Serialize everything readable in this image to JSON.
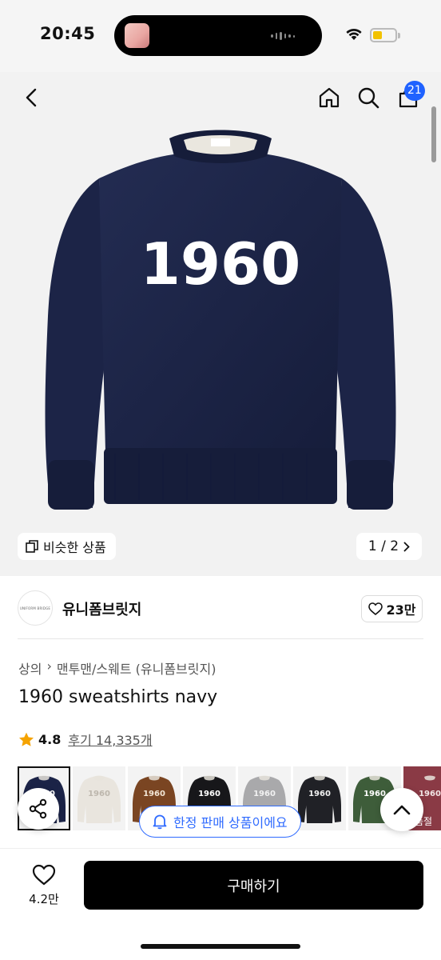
{
  "status_bar": {
    "time": "20:45"
  },
  "nav": {
    "cart_badge": "21"
  },
  "hero": {
    "print_text": "1960",
    "similar_label": "비슷한 상품",
    "pager": "1 / 2"
  },
  "brand": {
    "name": "유니폼브릿지",
    "logo_text": "UNIFORM BRIDGE",
    "likes": "23만"
  },
  "product": {
    "breadcrumb": [
      "상의",
      "맨투맨/스웨트 (유니폼브릿지)"
    ],
    "title": "1960 sweatshirts navy",
    "rating": "4.8",
    "review_label": "후기 14,335개"
  },
  "thumbnails": [
    {
      "name": "navy",
      "bg": "#f3f3f3",
      "color": "#1b2347",
      "text_color": "#ffffff",
      "selected": true
    },
    {
      "name": "ivory",
      "bg": "#f3f3f3",
      "color": "#e9e5de",
      "text_color": "#bdb7ad",
      "selected": false
    },
    {
      "name": "brown",
      "bg": "#f3f3f3",
      "color": "#7a4522",
      "text_color": "#f3e6d6",
      "selected": false
    },
    {
      "name": "black",
      "bg": "#f3f3f3",
      "color": "#17171a",
      "text_color": "#ffffff",
      "selected": false
    },
    {
      "name": "grey",
      "bg": "#f3f3f3",
      "color": "#a9a9ab",
      "text_color": "#f2f2f2",
      "selected": false
    },
    {
      "name": "charcoal",
      "bg": "#f3f3f3",
      "color": "#202126",
      "text_color": "#f2f2f2",
      "selected": false
    },
    {
      "name": "green",
      "bg": "#f3f3f3",
      "color": "#3e5d3a",
      "text_color": "#ffffff",
      "selected": false
    },
    {
      "name": "burgundy",
      "bg": "#8a3a45",
      "color": "#8a3a45",
      "text_color": "#f2e5e5",
      "selected": false
    }
  ],
  "thumb_text": "1960",
  "soldout_label": "품절",
  "limited_pill": "한정 판매 상품이에요",
  "bottom": {
    "wish_count": "4.2만",
    "buy_label": "구매하기"
  },
  "colors": {
    "accent": "#1f62ff",
    "navy": "#1b2347"
  }
}
